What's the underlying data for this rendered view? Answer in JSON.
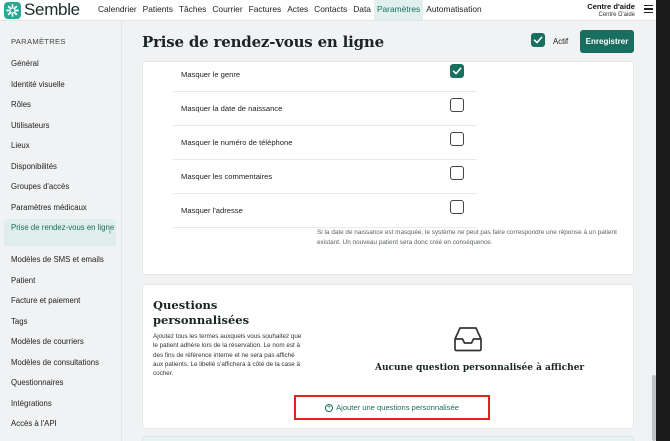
{
  "app": {
    "name": "Semble"
  },
  "nav": {
    "items": [
      "Calendrier",
      "Patients",
      "Tâches",
      "Courrier",
      "Factures",
      "Actes",
      "Contacts",
      "Data",
      "Paramètres",
      "Automatisation"
    ],
    "active": "Paramètres"
  },
  "help": {
    "title": "Centre d'aide",
    "subtitle": "Centre D'aide"
  },
  "sidebar": {
    "heading": "PARAMÈTRES",
    "items": [
      "Général",
      "Identité visuelle",
      "Rôles",
      "Utilisateurs",
      "Lieux",
      "Disponibilités",
      "Groupes d'accès",
      "Paramètres médicaux",
      "Prise de rendez-vous en ligne",
      "Modèles de SMS et emails",
      "Patient",
      "Facture et paiement",
      "Tags",
      "Modèles de courriers",
      "Modèles de consultations",
      "Questionnaires",
      "Intégrations",
      "Accès à l'API"
    ],
    "active": "Prise de rendez-vous en ligne"
  },
  "page": {
    "title": "Prise de rendez-vous en ligne",
    "actif_label": "Actif",
    "actif_checked": true,
    "save_label": "Enregistrer"
  },
  "options": {
    "rows": [
      {
        "label": "Masquer le genre",
        "checked": true
      },
      {
        "label": "Masquer la date de naissance",
        "checked": false
      },
      {
        "label": "Masquer le numéro de téléphone",
        "checked": false
      },
      {
        "label": "Masquer les commentaires",
        "checked": false
      },
      {
        "label": "Masquer l'adresse",
        "checked": false
      }
    ],
    "note": "Si la date de naissance est masquée, le système ne peut pas faire correspondre une réponse à un patient existant. Un nouveau patient sera donc créé en conséquence."
  },
  "questions": {
    "title": "Questions personnalisées",
    "description": "Ajoutez tous les termes auxquels vous souhaitez que le patient adhère lors de la réservation. Le nom est à des fins de référence interne et ne sera pas affiché aux patients. Le libellé s'affichera à côté de la case à cocher.",
    "empty_text": "Aucune question personnalisée à afficher",
    "add_label": "Ajouter une questions personnalisée"
  },
  "colors": {
    "brand": "#1a6e60",
    "accent": "#2ba891",
    "highlight": "#e0241d"
  },
  "icons": {
    "logo": "semble-logo-icon",
    "menu": "hamburger-menu-icon",
    "empty": "inbox-tray-icon",
    "add": "plus-circle-icon",
    "chevron": "chevron-right-icon"
  }
}
